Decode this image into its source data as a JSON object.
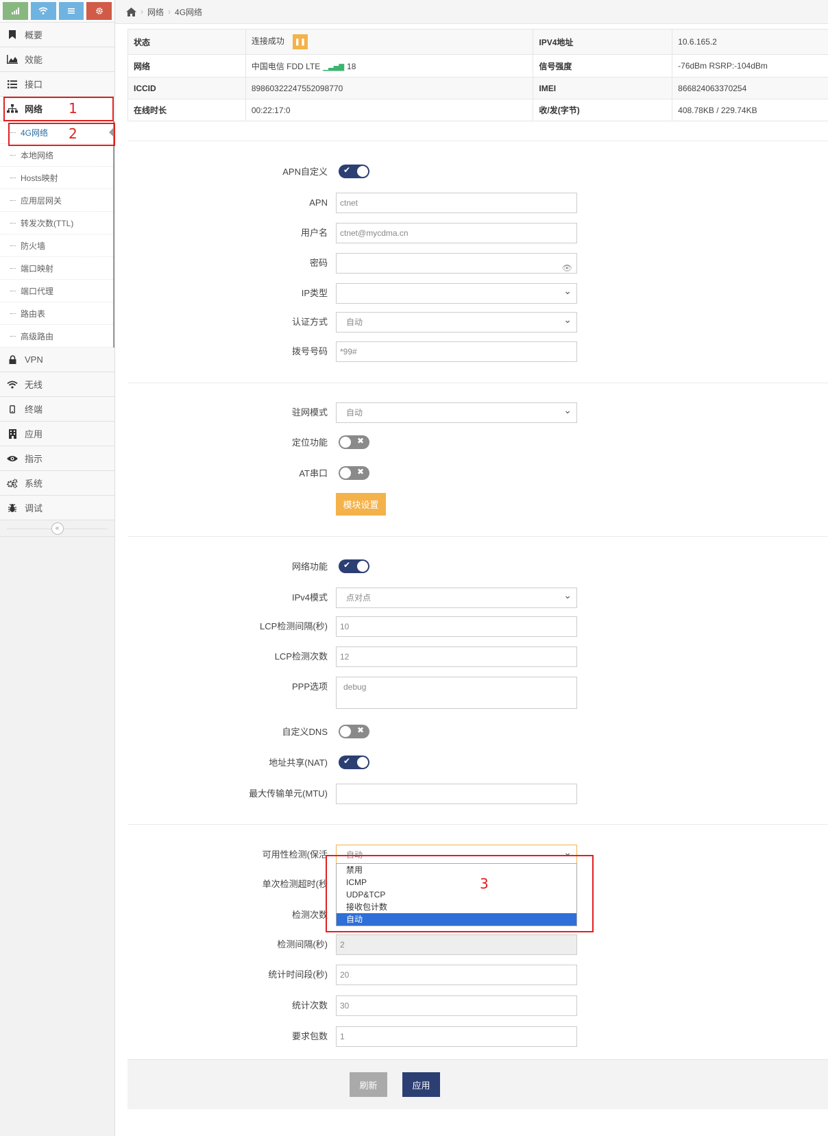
{
  "sidebar": {
    "shortcuts": [
      {
        "icon": "signal-icon",
        "color": "#87b87f"
      },
      {
        "icon": "wifi-icon",
        "color": "#6fb3e0"
      },
      {
        "icon": "list-icon",
        "color": "#6fb3e0"
      },
      {
        "icon": "gear-icon",
        "color": "#d15b47"
      }
    ],
    "items_top": [
      {
        "label": "概要",
        "icon": "bookmark-icon"
      },
      {
        "label": "效能",
        "icon": "area-chart-icon"
      },
      {
        "label": "接口",
        "icon": "list-icon"
      },
      {
        "label": "网络",
        "icon": "sitemap-icon"
      }
    ],
    "submenu": [
      "4G网络",
      "本地网络",
      "Hosts映射",
      "应用层网关",
      "转发次数(TTL)",
      "防火墙",
      "端口映射",
      "端口代理",
      "路由表",
      "高级路由"
    ],
    "items_bottom": [
      {
        "label": "VPN",
        "icon": "lock-icon"
      },
      {
        "label": "无线",
        "icon": "wifi-icon"
      },
      {
        "label": "终端",
        "icon": "mobile-icon"
      },
      {
        "label": "应用",
        "icon": "building-icon"
      },
      {
        "label": "指示",
        "icon": "eye-icon"
      },
      {
        "label": "系统",
        "icon": "cogs-icon"
      },
      {
        "label": "调试",
        "icon": "bug-icon"
      }
    ],
    "collapse_glyph": "«"
  },
  "annotations": [
    "1",
    "2",
    "3"
  ],
  "breadcrumb": {
    "items": [
      "网络",
      "4G网络"
    ]
  },
  "status": {
    "state_label": "状态",
    "state_value": "连接成功",
    "ipv4_label": "IPV4地址",
    "ipv4_value": "10.6.165.2",
    "network_label": "网络",
    "network_value": "中国电信  FDD LTE",
    "network_signal": "18",
    "strength_label": "信号强度",
    "strength_value": "-76dBm  RSRP:-104dBm",
    "iccid_label": "ICCID",
    "iccid_value": "89860322247552098770",
    "imei_label": "IMEI",
    "imei_value": "866824063370254",
    "uptime_label": "在线时长",
    "uptime_value": "00:22:17:0",
    "traffic_label": "收/发(字节)",
    "traffic_value": "408.78KB / 229.74KB"
  },
  "form_apn": {
    "apn_custom_label": "APN自定义",
    "apn_custom_on": true,
    "apn_label": "APN",
    "apn_value": "ctnet",
    "user_label": "用户名",
    "user_value": "ctnet@mycdma.cn",
    "password_label": "密码",
    "password_value": "",
    "iptype_label": "IP类型",
    "iptype_value": "",
    "auth_label": "认证方式",
    "auth_value": "自动",
    "dial_label": "拨号号码",
    "dial_value": "*99#"
  },
  "form_module": {
    "mode_label": "驻网模式",
    "mode_value": "自动",
    "gps_label": "定位功能",
    "gps_on": false,
    "at_label": "AT串口",
    "at_on": false,
    "module_button": "模块设置"
  },
  "form_net": {
    "net_func_label": "网络功能",
    "net_func_on": true,
    "ipv4mode_label": "IPv4模式",
    "ipv4mode_value": "点对点",
    "lcp_interval_label": "LCP检测间隔(秒)",
    "lcp_interval_value": "10",
    "lcp_count_label": "LCP检测次数",
    "lcp_count_value": "12",
    "ppp_label": "PPP选项",
    "ppp_value": "debug",
    "dns_label": "自定义DNS",
    "dns_on": false,
    "nat_label": "地址共享(NAT)",
    "nat_on": true,
    "mtu_label": "最大传输单元(MTU)",
    "mtu_value": ""
  },
  "form_keepalive": {
    "check_label": "可用性检测(保活",
    "check_value": "自动",
    "timeout_label": "单次检测超时(秒",
    "count_label": "检测次数",
    "interval_label": "检测间隔(秒)",
    "interval_value": "2",
    "stat_period_label": "统计时间段(秒)",
    "stat_period_value": "20",
    "stat_count_label": "统计次数",
    "stat_count_value": "30",
    "packets_label": "要求包数",
    "packets_value": "1",
    "options": [
      "禁用",
      "ICMP",
      "UDP&TCP",
      "接收包计数",
      "自动"
    ],
    "selected_option": "自动"
  },
  "footer": {
    "refresh": "刷新",
    "apply": "应用"
  },
  "colors": {
    "accent": "#2c3f73",
    "warning": "#f4b24a",
    "annotation": "#e02020",
    "selected": "#2e6fd8"
  }
}
